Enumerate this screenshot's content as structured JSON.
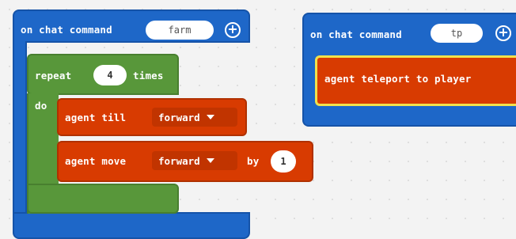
{
  "blocks": {
    "farm": {
      "event_prefix": "on chat command",
      "command": "farm",
      "repeat_label": "repeat",
      "repeat_count": "4",
      "times_label": "times",
      "do_label": "do",
      "till": {
        "label": "agent till",
        "direction": "forward"
      },
      "move": {
        "label": "agent move",
        "direction": "forward",
        "by_label": "by",
        "amount": "1"
      }
    },
    "tp": {
      "event_prefix": "on chat command",
      "command": "tp",
      "action": "agent teleport to player"
    }
  },
  "colors": {
    "event": "#1e67c8",
    "loop": "#58973a",
    "agent": "#d83b01",
    "highlight": "#f2e14b",
    "workspace": "#f3f3f3"
  },
  "icons": {
    "add": "add-parameter-icon",
    "dropdown": "dropdown-arrow-icon"
  }
}
